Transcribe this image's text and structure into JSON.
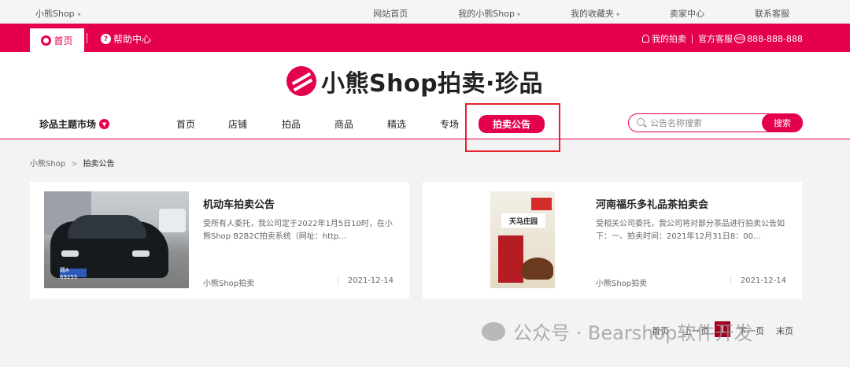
{
  "topbar": {
    "shop_name": "小熊Shop",
    "links": [
      {
        "label": "网站首页",
        "dropdown": false
      },
      {
        "label": "我的小熊Shop",
        "dropdown": true
      },
      {
        "label": "我的收藏夹",
        "dropdown": true
      },
      {
        "label": "卖家中心",
        "dropdown": false
      },
      {
        "label": "联系客服",
        "dropdown": false
      }
    ]
  },
  "redbar": {
    "home_label": "首页",
    "help_label": "帮助中心",
    "my_auction": "我的拍卖",
    "service_label": "官方客服",
    "phone_badge": "400",
    "phone": "888-888-888"
  },
  "header": {
    "logo_text": "小熊Shop拍卖·珍品",
    "theme_market": "珍品主题市场",
    "nav": [
      "首页",
      "店铺",
      "拍品",
      "商品",
      "精选",
      "专场",
      "拍卖公告"
    ],
    "active_nav": "拍卖公告",
    "search": {
      "placeholder": "公告名称搜索",
      "button": "搜索"
    }
  },
  "breadcrumb": {
    "root": "小熊Shop",
    "separator": ">",
    "current": "拍卖公告"
  },
  "announcements": [
    {
      "title": "机动车拍卖公告",
      "desc": "受所有人委托，我公司定于2022年1月5日10时，在小熊Shop B2B2C拍卖系统（网址：http...",
      "source": "小熊Shop拍卖",
      "date": "2021-12-14",
      "plate_text": "赣A 69255"
    },
    {
      "title": "河南福乐多礼品茶拍卖会",
      "desc": "受相关公司委托，我公司将对部分茶品进行拍卖公告如下：一、拍卖时间：2021年12月31日8：00...",
      "source": "小熊Shop拍卖",
      "date": "2021-12-14",
      "product_text": "天马庄园"
    }
  ],
  "pagination": {
    "first": "首页",
    "prev": "上一页",
    "current": "1",
    "next": "下一页",
    "last": "末页"
  },
  "watermark": "公众号 · Bearshop软件开发",
  "colors": {
    "brand": "#e5004f",
    "highlight_box": "#e5232a",
    "page_current": "#a50020"
  }
}
